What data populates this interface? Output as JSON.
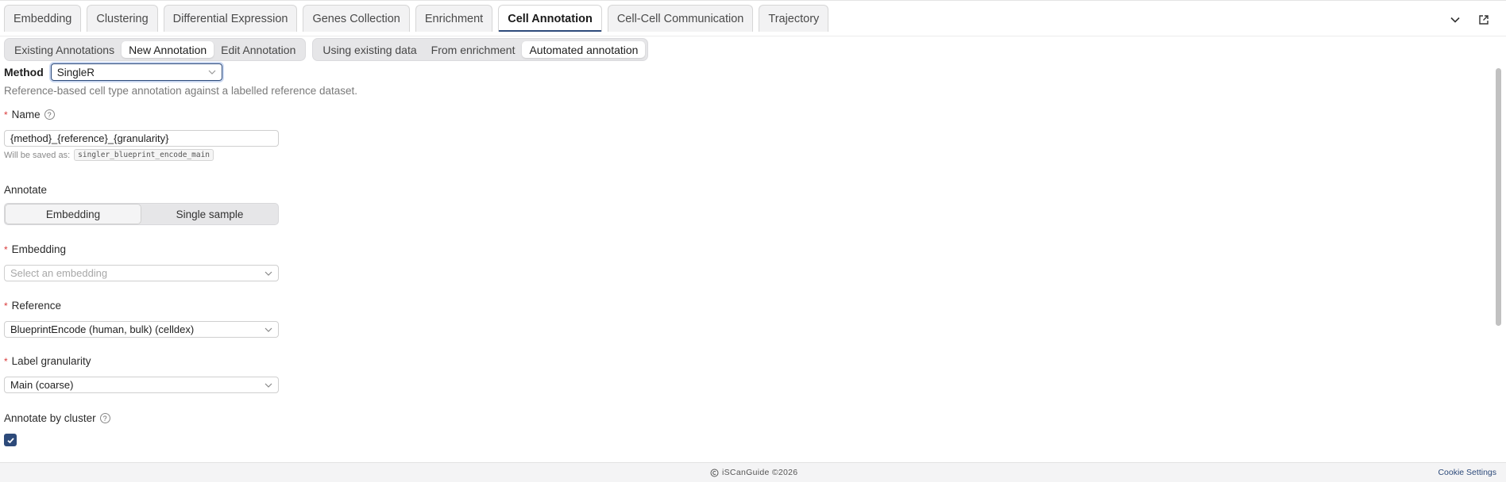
{
  "tabs": [
    {
      "label": "Embedding"
    },
    {
      "label": "Clustering"
    },
    {
      "label": "Differential Expression"
    },
    {
      "label": "Genes Collection"
    },
    {
      "label": "Enrichment"
    },
    {
      "label": "Cell Annotation"
    },
    {
      "label": "Cell-Cell Communication"
    },
    {
      "label": "Trajectory"
    }
  ],
  "subtabs_mode": [
    "Existing Annotations",
    "New Annotation",
    "Edit Annotation"
  ],
  "subtabs_source": [
    "Using existing data",
    "From enrichment",
    "Automated annotation"
  ],
  "form": {
    "method_label": "Method",
    "method_value": "SingleR",
    "description": "Reference-based cell type annotation against a labelled reference dataset.",
    "required_mark": "*",
    "name_label": "Name",
    "name_value": "{method}_{reference}_{granularity}",
    "saved_as_prefix": "Will be saved as:",
    "saved_as_value": "singler_blueprint_encode_main",
    "annotate_label": "Annotate",
    "annotate_options": [
      "Embedding",
      "Single sample"
    ],
    "embedding_label": "Embedding",
    "embedding_placeholder": "Select an embedding",
    "reference_label": "Reference",
    "reference_value": "BlueprintEncode (human, bulk) (celldex)",
    "granularity_label": "Label granularity",
    "granularity_value": "Main (coarse)",
    "cluster_label": "Annotate by cluster"
  },
  "footer": {
    "copyright": "iSCanGuide ©2026",
    "cookie": "Cookie Settings"
  },
  "colors": {
    "accent": "#2d4a7a",
    "required": "#d93a3a"
  }
}
